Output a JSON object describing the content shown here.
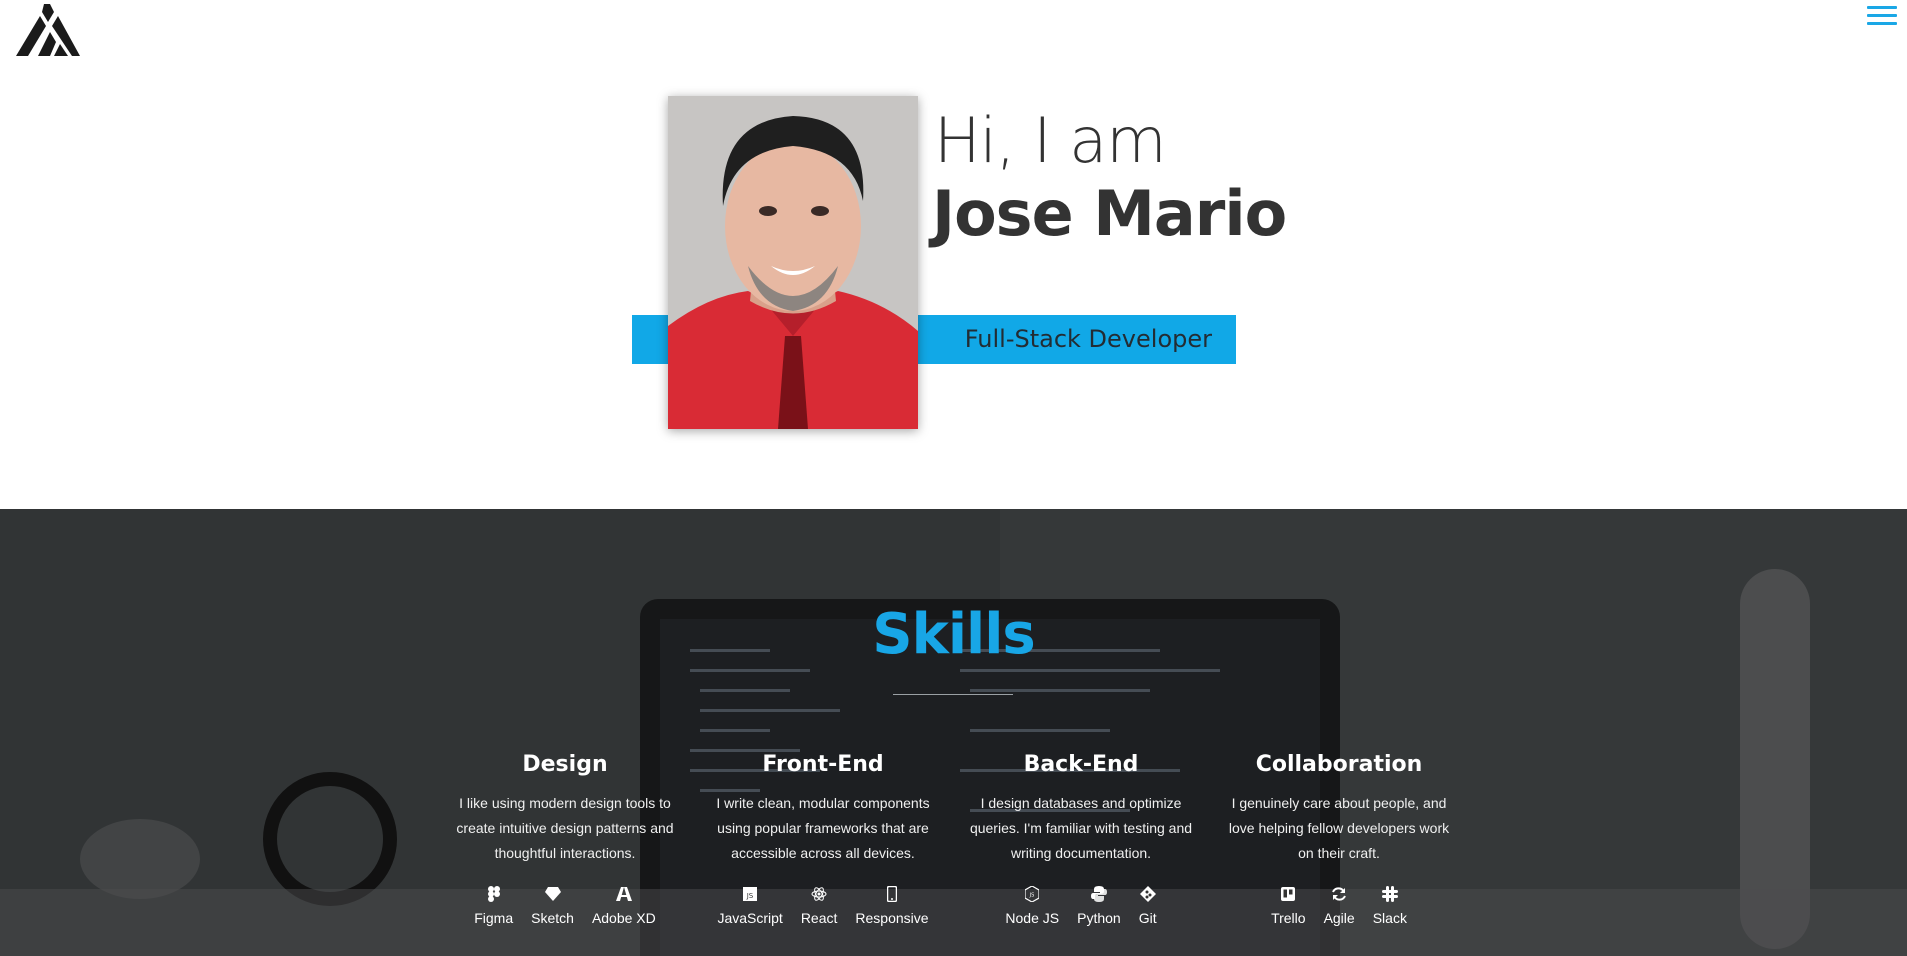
{
  "header": {
    "logo_icon": "jm-triangle-logo-icon",
    "menu_icon": "hamburger-menu-icon",
    "accent": "#1aa7e6"
  },
  "hero": {
    "greeting": "Hi, I am",
    "name": "Jose Mario",
    "role": "Full-Stack Developer",
    "banner_color": "#11a8e7"
  },
  "skills": {
    "title": "Skills",
    "title_color": "#18a6e6",
    "columns": [
      {
        "title": "Design",
        "description": "I like using modern design tools to create intuitive design patterns and thoughtful interactions.",
        "tools": [
          {
            "label": "Figma",
            "icon": "figma-icon"
          },
          {
            "label": "Sketch",
            "icon": "sketch-icon"
          },
          {
            "label": "Adobe XD",
            "icon": "adobe-xd-icon"
          }
        ]
      },
      {
        "title": "Front-End",
        "description": "I write clean, modular components using popular frameworks that are accessible across all devices.",
        "tools": [
          {
            "label": "JavaScript",
            "icon": "javascript-icon"
          },
          {
            "label": "React",
            "icon": "react-icon"
          },
          {
            "label": "Responsive",
            "icon": "mobile-icon"
          }
        ]
      },
      {
        "title": "Back-End",
        "description": "I design databases and optimize queries. I'm familiar with testing and writing documentation.",
        "tools": [
          {
            "label": "Node JS",
            "icon": "nodejs-icon"
          },
          {
            "label": "Python",
            "icon": "python-icon"
          },
          {
            "label": "Git",
            "icon": "git-icon"
          }
        ]
      },
      {
        "title": "Collaboration",
        "description": "I genuinely care about people, and love helping fellow developers work on their craft.",
        "tools": [
          {
            "label": "Trello",
            "icon": "trello-icon"
          },
          {
            "label": "Agile",
            "icon": "sync-icon"
          },
          {
            "label": "Slack",
            "icon": "slack-icon"
          }
        ]
      }
    ]
  }
}
